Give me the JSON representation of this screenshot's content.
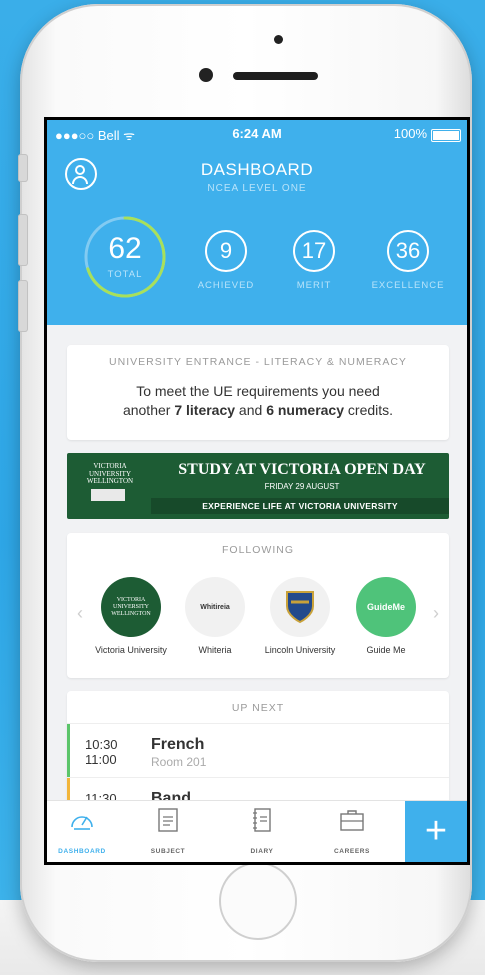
{
  "status_bar": {
    "carrier": "●●●○○ Bell ᯤ",
    "time": "6:24 AM",
    "battery": "100%"
  },
  "header": {
    "title": "DASHBOARD",
    "subtitle": "NCEA LEVEL ONE",
    "total": {
      "value": "62",
      "label": "TOTAL",
      "progress_fraction": 0.7
    },
    "stats": [
      {
        "value": "9",
        "label": "ACHIEVED"
      },
      {
        "value": "17",
        "label": "MERIT"
      },
      {
        "value": "36",
        "label": "EXCELLENCE"
      }
    ]
  },
  "ue_card": {
    "heading": "UNIVERSITY ENTRANCE - LITERACY & NUMERACY",
    "line1": "To meet the UE requirements you need",
    "line2_prefix": "another ",
    "literacy": "7 literacy",
    "line2_mid": " and ",
    "numeracy": "6 numeracy",
    "line2_suffix": " credits."
  },
  "banner": {
    "logo_text": "VICTORIA UNIVERSITY WELLINGTON",
    "headline": "STUDY AT VICTORIA OPEN DAY",
    "date": "FRIDAY 29 AUGUST",
    "strip": "EXPERIENCE LIFE AT VICTORIA UNIVERSITY"
  },
  "following": {
    "heading": "FOLLOWING",
    "items": [
      {
        "name": "Victoria University",
        "logo_text": "VICTORIA UNIVERSITY WELLINGTON",
        "color": "#1d5c34"
      },
      {
        "name": "Whiteria",
        "logo_text": "Whitireia",
        "color": "#f1f1f1"
      },
      {
        "name": "Lincoln University",
        "logo_text": "",
        "color": "#f1f1f1"
      },
      {
        "name": "Guide Me",
        "logo_text": "GuideMe",
        "color": "#4fc37a"
      }
    ]
  },
  "up_next": {
    "heading": "UP NEXT",
    "rows": [
      {
        "start": "10:30",
        "end": "11:00",
        "subject": "French",
        "room": "Room 201",
        "color": "#5cc56a"
      },
      {
        "start": "11:30",
        "end": "",
        "subject": "Band",
        "room": "",
        "color": "#f2b53a"
      }
    ]
  },
  "tabs": [
    {
      "label": "DASHBOARD",
      "icon": "gauge-icon",
      "active": true
    },
    {
      "label": "SUBJECT",
      "icon": "document-icon",
      "active": false
    },
    {
      "label": "DIARY",
      "icon": "notebook-icon",
      "active": false
    },
    {
      "label": "CAREERS",
      "icon": "briefcase-icon",
      "active": false
    }
  ],
  "add_button": "+",
  "colors": {
    "accent": "#3fb0ec",
    "progress_ring": "#a8e05a",
    "banner_green": "#1d5c34"
  }
}
